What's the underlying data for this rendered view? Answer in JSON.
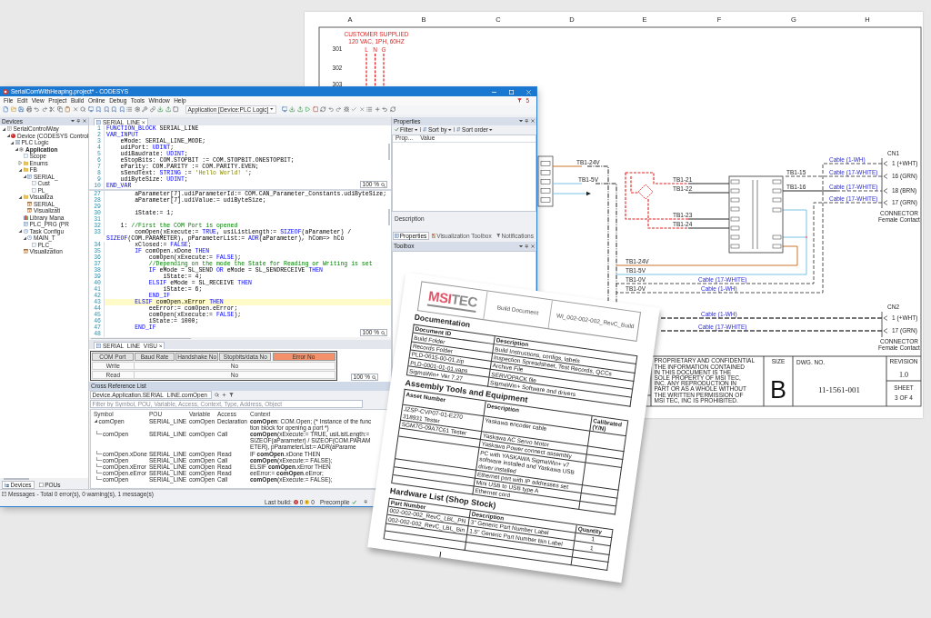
{
  "ide": {
    "title": "SerialComWithHeaping.project* - CODESYS",
    "menu": [
      "File",
      "Edit",
      "View",
      "Project",
      "Build",
      "Online",
      "Debug",
      "Tools",
      "Window",
      "Help"
    ],
    "notification_count": "5",
    "application_selector": "Application [Device:PLC Logic]",
    "devices_panel": {
      "title": "Devices",
      "tree": [
        {
          "label": "SerialControlWay",
          "kind": "project",
          "expanded": true,
          "children": [
            {
              "label": "Device (CODESYS Control",
              "kind": "device",
              "expanded": true,
              "children": [
                {
                  "label": "PLC Logic",
                  "kind": "plc",
                  "expanded": true,
                  "children": [
                    {
                      "label": "Application",
                      "kind": "application",
                      "expanded": true,
                      "children": [
                        {
                          "label": "Scope",
                          "kind": "object"
                        },
                        {
                          "label": "Enums",
                          "kind": "folder",
                          "expanded": false
                        },
                        {
                          "label": "FB",
                          "kind": "folder",
                          "expanded": true,
                          "children": [
                            {
                              "label": "SERIAL_",
                              "kind": "pou",
                              "expanded": true,
                              "children": [
                                {
                                  "label": "Cust",
                                  "kind": "object"
                                },
                                {
                                  "label": "PL_",
                                  "kind": "object"
                                }
                              ]
                            }
                          ]
                        },
                        {
                          "label": "Visualiza",
                          "kind": "folder",
                          "expanded": true,
                          "children": [
                            {
                              "label": "SERIAL_",
                              "kind": "visu"
                            },
                            {
                              "label": "Visualizati",
                              "kind": "visu"
                            }
                          ]
                        },
                        {
                          "label": "Library Mana",
                          "kind": "library"
                        },
                        {
                          "label": "PLC_PRG (PR",
                          "kind": "pou"
                        },
                        {
                          "label": "Task Configu",
                          "kind": "task",
                          "expanded": true,
                          "children": [
                            {
                              "label": "MAIN_T",
                              "kind": "task",
                              "expanded": true,
                              "children": [
                                {
                                  "label": "PLC_",
                                  "kind": "object"
                                }
                              ]
                            }
                          ]
                        },
                        {
                          "label": "Visualization",
                          "kind": "visu"
                        }
                      ]
                    }
                  ]
                }
              ]
            }
          ]
        }
      ]
    },
    "editor": {
      "tab": "SERIAL_LINE",
      "declaration": [
        {
          "number": "1",
          "code": [
            {
              "text": "FUNCTION_BLOCK",
              "kind": "keyword"
            },
            {
              "text": " SERIAL_LINE",
              "kind": "plain"
            }
          ]
        },
        {
          "number": "2",
          "code": [
            {
              "text": "VAR_INPUT",
              "kind": "keyword"
            }
          ]
        },
        {
          "number": "3",
          "code": [
            {
              "text": "    eMode: SERIAL_LINE_MODE;",
              "kind": "plain"
            }
          ]
        },
        {
          "number": "4",
          "code": [
            {
              "text": "    udiPort: ",
              "kind": "plain"
            },
            {
              "text": "UDINT",
              "kind": "keyword"
            },
            {
              "text": ";",
              "kind": "plain"
            }
          ]
        },
        {
          "number": "5",
          "code": [
            {
              "text": "    udiBaudrate: ",
              "kind": "plain"
            },
            {
              "text": "UDINT",
              "kind": "keyword"
            },
            {
              "text": ";",
              "kind": "plain"
            }
          ]
        },
        {
          "number": "6",
          "code": [
            {
              "text": "    eStopBits: COM.STOPBIT := COM.STOPBIT.ONESTOPBIT;",
              "kind": "plain"
            }
          ]
        },
        {
          "number": "7",
          "code": [
            {
              "text": "    eParity: COM.PARITY := COM.PARITY.EVEN;",
              "kind": "plain"
            }
          ]
        },
        {
          "number": "8",
          "code": [
            {
              "text": "    sSendText: ",
              "kind": "plain"
            },
            {
              "text": "STRING",
              "kind": "keyword"
            },
            {
              "text": " := ",
              "kind": "plain"
            },
            {
              "text": "'Hello World! '",
              "kind": "string"
            },
            {
              "text": ";",
              "kind": "plain"
            }
          ]
        },
        {
          "number": "9",
          "code": [
            {
              "text": "    udiByteSize: ",
              "kind": "plain"
            },
            {
              "text": "UDINT",
              "kind": "keyword"
            },
            {
              "text": ";",
              "kind": "plain"
            }
          ]
        },
        {
          "number": "10",
          "code": [
            {
              "text": "END_VAR",
              "kind": "keyword"
            }
          ]
        }
      ],
      "declaration_zoom": "100 %",
      "implementation": [
        {
          "number": "27",
          "highlighted": false,
          "code": [
            {
              "text": "        aParameter[7].udiParameterId:= COM.CAN_Parameter_Constants.udiByteSize;",
              "kind": "plain"
            }
          ]
        },
        {
          "number": "28",
          "highlighted": false,
          "code": [
            {
              "text": "        aParameter[7].udiValue:= udiByteSize;",
              "kind": "plain"
            }
          ]
        },
        {
          "number": "29",
          "highlighted": false
        },
        {
          "number": "30",
          "highlighted": false,
          "code": [
            {
              "text": "        iState:= 1;",
              "kind": "plain"
            }
          ]
        },
        {
          "number": "31",
          "highlighted": false
        },
        {
          "number": "32",
          "highlighted": false,
          "code": [
            {
              "text": "    1: ",
              "kind": "plain"
            },
            {
              "text": "//First the COM Port is opened",
              "kind": "comment"
            }
          ]
        },
        {
          "number": "33",
          "highlighted": false,
          "code": [
            {
              "text": "        comOpen(xExecute:= ",
              "kind": "plain"
            },
            {
              "text": "TRUE",
              "kind": "keyword"
            },
            {
              "text": ", usiListLength:= ",
              "kind": "plain"
            },
            {
              "text": "SIZEOF",
              "kind": "keyword"
            },
            {
              "text": "(aParameter) / ",
              "kind": "plain"
            },
            {
              "text": "SIZEOF",
              "kind": "keyword"
            },
            {
              "text": "(COM.PARAMETER), pParameterList:= ",
              "kind": "plain"
            },
            {
              "text": "ADR",
              "kind": "keyword"
            },
            {
              "text": "(aParameter), hCom=> hCo",
              "kind": "plain"
            }
          ]
        },
        {
          "number": "34",
          "highlighted": false,
          "code": [
            {
              "text": "        xClosed:= ",
              "kind": "plain"
            },
            {
              "text": "FALSE",
              "kind": "keyword"
            },
            {
              "text": ";",
              "kind": "plain"
            }
          ]
        },
        {
          "number": "35",
          "highlighted": false,
          "code": [
            {
              "text": "        IF",
              "kind": "keyword"
            },
            {
              "text": " comOpen.xDone ",
              "kind": "plain"
            },
            {
              "text": "THEN",
              "kind": "keyword"
            }
          ]
        },
        {
          "number": "36",
          "highlighted": false,
          "code": [
            {
              "text": "            comOpen(xExecute:= ",
              "kind": "plain"
            },
            {
              "text": "FALSE",
              "kind": "keyword"
            },
            {
              "text": ");",
              "kind": "plain"
            }
          ]
        },
        {
          "number": "37",
          "highlighted": false,
          "code": [
            {
              "text": "            //Depending on the mode the State for Reading or Writing is set",
              "kind": "comment"
            }
          ]
        },
        {
          "number": "38",
          "highlighted": false,
          "code": [
            {
              "text": "            IF",
              "kind": "keyword"
            },
            {
              "text": " eMode = SL_SEND ",
              "kind": "plain"
            },
            {
              "text": "OR",
              "kind": "keyword"
            },
            {
              "text": " eMode = SL_SENDRECEIVE ",
              "kind": "plain"
            },
            {
              "text": "THEN",
              "kind": "keyword"
            }
          ]
        },
        {
          "number": "39",
          "highlighted": false,
          "code": [
            {
              "text": "                iState:= 4;",
              "kind": "plain"
            }
          ]
        },
        {
          "number": "40",
          "highlighted": false,
          "code": [
            {
              "text": "            ELSIF",
              "kind": "keyword"
            },
            {
              "text": " eMode = SL_RECEIVE ",
              "kind": "plain"
            },
            {
              "text": "THEN",
              "kind": "keyword"
            }
          ]
        },
        {
          "number": "41",
          "highlighted": false,
          "code": [
            {
              "text": "                iState:= 6;",
              "kind": "plain"
            }
          ]
        },
        {
          "number": "42",
          "highlighted": false,
          "code": [
            {
              "text": "            END_IF",
              "kind": "keyword"
            }
          ]
        },
        {
          "number": "43",
          "highlighted": true,
          "code": [
            {
              "text": "        ELSIF",
              "kind": "keyword"
            },
            {
              "text": " comOpen.xError ",
              "kind": "plain"
            },
            {
              "text": "THEN",
              "kind": "keyword"
            }
          ]
        },
        {
          "number": "44",
          "highlighted": false,
          "code": [
            {
              "text": "            eeError:= comOpen.eError;",
              "kind": "plain"
            }
          ]
        },
        {
          "number": "45",
          "highlighted": false,
          "code": [
            {
              "text": "            comOpen(xExecute:= ",
              "kind": "plain"
            },
            {
              "text": "FALSE",
              "kind": "keyword"
            },
            {
              "text": ");",
              "kind": "plain"
            }
          ]
        },
        {
          "number": "46",
          "highlighted": false,
          "code": [
            {
              "text": "            iState:= 1000;",
              "kind": "plain"
            }
          ]
        },
        {
          "number": "47",
          "highlighted": false,
          "code": [
            {
              "text": "        END_IF",
              "kind": "keyword"
            }
          ]
        },
        {
          "number": "48",
          "highlighted": false
        }
      ],
      "implementation_zoom": "100 %"
    },
    "visu_editor": {
      "tab": "SERIAL_LINE_VISU",
      "header": [
        {
          "label": "COM Port",
          "color": "#e4e4e4"
        },
        {
          "label": "Baud Rate",
          "color": "#e4e4e4"
        },
        {
          "label": "Handshake No",
          "color": "#e4e4e4"
        },
        {
          "label": "Stopbits/data No",
          "color": "#e4e4e4"
        },
        {
          "label": "Error No",
          "color": "#f4916a"
        }
      ],
      "rows": [
        {
          "label": "Write",
          "value": "No"
        },
        {
          "label": "Read",
          "value": "No"
        }
      ],
      "zoom": "100 %"
    },
    "cross_reference": {
      "title": "Cross Reference List",
      "search": "Device.Application.SERIAL_LINE.comOpen",
      "filter_placeholder": "Filter by Symbol, POU, Variable, Access, Context, Type, Address, Object",
      "columns": [
        "Symbol",
        "POU",
        "Variable",
        "Access",
        "Context"
      ],
      "rows": [
        {
          "symbol": "comOpen",
          "pou": "SERIAL_LINE",
          "variable": "comOpen",
          "access": "Declaration",
          "context": "**comOpen**: COM.Open; (* Instance of the function block for opening a port *)",
          "expanded": true,
          "children": [
            {
              "symbol": "comOpen",
              "pou": "SERIAL_LINE",
              "variable": "comOpen",
              "access": "Call",
              "context": "**comOpen**(xExecute:= TRUE, usiListLength:= SIZEOF(aParameter) / SIZEOF(COM.PARAMETER), pParameterList:= ADR(aParame"
            },
            {
              "symbol": "comOpen.xDone",
              "pou": "SERIAL_LINE",
              "variable": "comOpen",
              "access": "Read",
              "context": "IF **comOpen**.xDone THEN"
            },
            {
              "symbol": "comOpen",
              "pou": "SERIAL_LINE",
              "variable": "comOpen",
              "access": "Call",
              "context": "**comOpen**(xExecute:= FALSE);"
            },
            {
              "symbol": "comOpen.xError",
              "pou": "SERIAL_LINE",
              "variable": "comOpen",
              "access": "Read",
              "context": "ELSIF **comOpen**.xError THEN"
            },
            {
              "symbol": "comOpen.eError",
              "pou": "SERIAL_LINE",
              "variable": "comOpen",
              "access": "Read",
              "context": "eeError:= **comOpen**.eError;"
            },
            {
              "symbol": "comOpen",
              "pou": "SERIAL_LINE",
              "variable": "comOpen",
              "access": "Call",
              "context": "**comOpen**(xExecute:= FALSE);"
            }
          ]
        }
      ]
    },
    "properties_panel": {
      "title": "Properties",
      "toolbar": [
        "Filter",
        "Sort by",
        "Sort order"
      ],
      "columns": [
        "Prop...",
        "Value"
      ],
      "description_label": "Description"
    },
    "side_tabs": [
      {
        "label": "Properties",
        "selected": true
      },
      {
        "label": "Visualization Toolbox",
        "selected": false
      },
      {
        "label": "Notifications",
        "selected": false
      }
    ],
    "toolbox_panel": {
      "title": "Toolbox"
    },
    "bottom_tabs": [
      {
        "label": "Devices",
        "selected": true
      },
      {
        "label": "POUs",
        "selected": false
      }
    ],
    "messages": "Messages - Total 0 error(s), 0 warning(s), 1 message(s)",
    "status": {
      "last_build": "Last build:",
      "errors": "0",
      "warnings": "0",
      "precompile": "Precompile",
      "precompile_ok": true
    }
  },
  "schematic": {
    "columns": [
      "A",
      "B",
      "C",
      "D",
      "E",
      "F",
      "G",
      "H"
    ],
    "rows": [
      "301",
      "302",
      "303"
    ],
    "supply_note": [
      "CUSTOMER SUPPLIED",
      "120 VAC, 1PH, 60HZ"
    ],
    "phases": [
      "L",
      "N",
      "G"
    ],
    "wire_labels": [
      "TB1-24V",
      "TB1-5V",
      "TB1-21",
      "TB1-22",
      "TB1-23",
      "TB1-24",
      "TB1-15",
      "TB1-16",
      "TB1-24V",
      "TB1-5V",
      "TB1-0V",
      "TB1-0V"
    ],
    "cable_labels": [
      "Cable (1-WH)",
      "Cable (17-WHITE)",
      "Cable (17-WHITE)",
      "Cable (17-WHITE)",
      "Cable (17-WHITE)",
      "Cable (1-WH)",
      "Cable (1-WH)",
      "Cable (17-WHITE)"
    ],
    "connectors": [
      {
        "name": "CN1",
        "pins": [
          "1 (+WHT)",
          "16 (GRN)",
          "18 (BRN)",
          "17 (GRN)"
        ],
        "caption": [
          "CONNECTOR",
          "Female Contact"
        ]
      },
      {
        "name": "CN2",
        "pins": [
          "1 (+WHT)",
          "17 (GRN)"
        ],
        "caption": [
          "CONNECTOR",
          "Female Contact"
        ]
      }
    ],
    "title_block": {
      "notice_title": "PROPRIETARY AND CONFIDENTIAL",
      "notice": "THE INFORMATION CONTAINED IN THIS DOCUMENT IS THE SOLE PROPERTY OF MSI TEC, INC. ANY REPRODUCTION IN PART OR AS A WHOLE WITHOUT THE WRITTEN PERMISSION OF MSI TEC, INC IS PROHIBITED.",
      "size_label": "SIZE",
      "size": "B",
      "dwg_label": "DWG. NO.",
      "dwg_no": "11-1561-001",
      "revision_label": "REVISION",
      "revision": "1.0",
      "sheet_label": "SHEET",
      "sheet": "3 OF 4"
    }
  },
  "document": {
    "logo": {
      "accent": "MSI",
      "rest": "TEC"
    },
    "title": "Build Document",
    "document_id": "WI_002-002-002_RevC_Build",
    "documentation": {
      "heading": "Documentation",
      "columns": [
        "Document ID",
        "Description"
      ],
      "rows": [
        {
          "document_id": "Build Folder",
          "description": "Build Instructions, configs, labels"
        },
        {
          "document_id": "Records Folder",
          "description": "Inspection Spreadsheet, Test Records, QCCs"
        },
        {
          "document_id": "PLD-0615-00-01.zip",
          "description": "Archive File"
        },
        {
          "document_id": "PLD-0001-01-01.vaps",
          "description": "SERVOPACK file"
        },
        {
          "document_id": "SigmaWin+ Ver 7.27",
          "description": "SigmaWin+ Software and drivers"
        }
      ]
    },
    "tools": {
      "heading": "Assembly Tools and Equipment",
      "columns": [
        "Asset Number",
        "Description",
        "Calibrated (Y/N)"
      ],
      "rows": [
        {
          "asset": "JZSP-CVP07-01-E270 318931 Tester",
          "description": "Yaskawa encoder cable"
        },
        {
          "asset": "SGM7G-09A7C61 Tester",
          "description": "Yaskawa AC Servo Motor"
        },
        {
          "description": "Yaskawa Power connect assembly"
        },
        {
          "description": "PC with YASKAWA SigmaWin+ v7 software installed and Yaskawa USB driver installed"
        },
        {
          "description": "Ethernet port with IP addresses set"
        },
        {
          "description": "Mini USB to USB type A"
        },
        {
          "description": "Ethernet cord"
        }
      ]
    },
    "hardware": {
      "heading": "Hardware List (Shop Stock)",
      "columns": [
        "Part Number",
        "Description",
        "Quantity"
      ],
      "rows": [
        {
          "part": "002-002-002_RevC_LBL_PN",
          "description": "3\" Generic Part Number Label",
          "quantity": "1"
        },
        {
          "part": "002-002-002_RevC_LBL_Bin",
          "description": "1.5\" Generic Part Number Bin Label",
          "quantity": "1"
        }
      ]
    }
  }
}
